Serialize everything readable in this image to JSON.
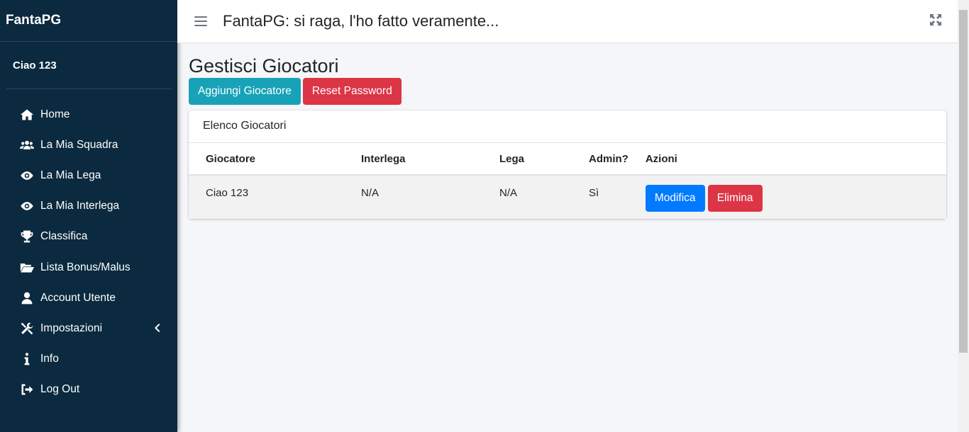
{
  "sidebar": {
    "brand": "FantaPG",
    "user": "Ciao 123",
    "items": [
      {
        "label": "Home",
        "icon": "home-icon"
      },
      {
        "label": "La Mia Squadra",
        "icon": "users-icon"
      },
      {
        "label": "La Mia Lega",
        "icon": "eye-icon"
      },
      {
        "label": "La Mia Interlega",
        "icon": "eye-icon"
      },
      {
        "label": "Classifica",
        "icon": "trophy-icon"
      },
      {
        "label": "Lista Bonus/Malus",
        "icon": "folder-open-icon"
      },
      {
        "label": "Account Utente",
        "icon": "user-icon"
      },
      {
        "label": "Impostazioni",
        "icon": "tools-icon"
      },
      {
        "label": "Info",
        "icon": "info-icon"
      },
      {
        "label": "Log Out",
        "icon": "sign-out-icon"
      }
    ]
  },
  "header": {
    "title": "FantaPG: si raga, l'ho fatto veramente..."
  },
  "main": {
    "page_title": "Gestisci Giocatori",
    "add_button": "Aggiungi Giocatore",
    "reset_button": "Reset Password",
    "card_title": "Elenco Giocatori",
    "columns": [
      "Giocatore",
      "Interlega",
      "Lega",
      "Admin?",
      "Azioni"
    ],
    "rows": [
      {
        "giocatore": "Ciao 123",
        "interlega": "N/A",
        "lega": "N/A",
        "admin": "Sì",
        "edit_label": "Modifica",
        "delete_label": "Elimina"
      }
    ]
  },
  "colors": {
    "sidebar_bg": "#0b2a3f",
    "info": "#17a2b8",
    "danger": "#dc3545",
    "primary": "#007bff"
  }
}
